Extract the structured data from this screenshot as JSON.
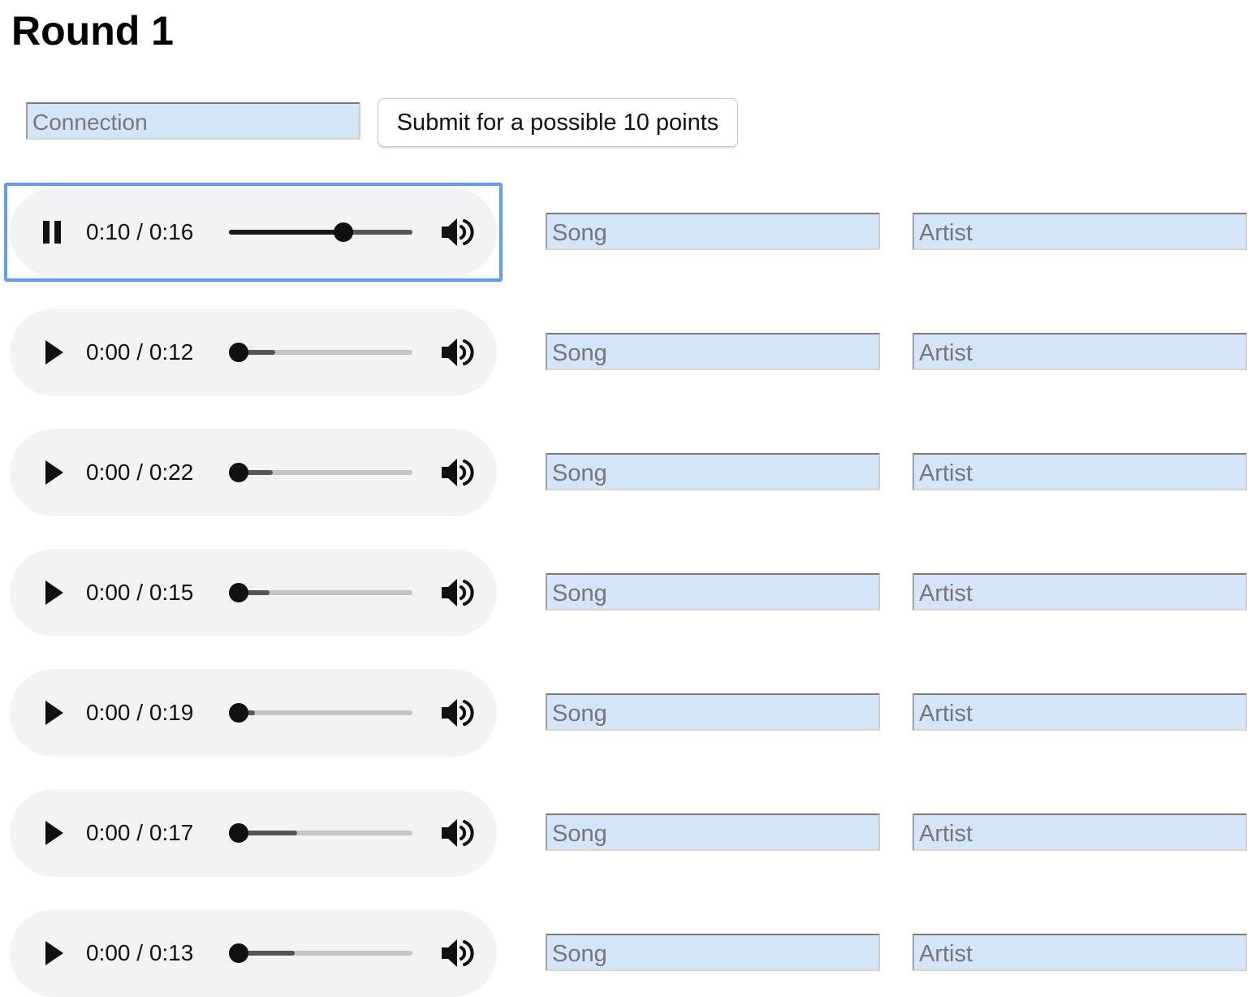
{
  "page": {
    "title": "Round 1"
  },
  "connection": {
    "placeholder": "Connection",
    "submit_label": "Submit for a possible 10 points"
  },
  "colors": {
    "input_background": "#d3e5f6",
    "player_background": "#f1f3f4",
    "focus_ring": "#5d9cf7"
  },
  "rows": [
    {
      "state": "playing",
      "time": "0:10 / 0:16",
      "progress": 0.625,
      "buffered": 1.0,
      "song_placeholder": "Song",
      "artist_placeholder": "Artist",
      "focused": true
    },
    {
      "state": "paused",
      "time": "0:00 / 0:12",
      "progress": 0.0,
      "buffered": 0.25,
      "song_placeholder": "Song",
      "artist_placeholder": "Artist",
      "focused": false
    },
    {
      "state": "paused",
      "time": "0:00 / 0:22",
      "progress": 0.0,
      "buffered": 0.24,
      "song_placeholder": "Song",
      "artist_placeholder": "Artist",
      "focused": false
    },
    {
      "state": "paused",
      "time": "0:00 / 0:15",
      "progress": 0.0,
      "buffered": 0.22,
      "song_placeholder": "Song",
      "artist_placeholder": "Artist",
      "focused": false
    },
    {
      "state": "paused",
      "time": "0:00 / 0:19",
      "progress": 0.0,
      "buffered": 0.14,
      "song_placeholder": "Song",
      "artist_placeholder": "Artist",
      "focused": false
    },
    {
      "state": "paused",
      "time": "0:00 / 0:17",
      "progress": 0.0,
      "buffered": 0.37,
      "song_placeholder": "Song",
      "artist_placeholder": "Artist",
      "focused": false
    },
    {
      "state": "paused",
      "time": "0:00 / 0:13",
      "progress": 0.0,
      "buffered": 0.36,
      "song_placeholder": "Song",
      "artist_placeholder": "Artist",
      "focused": false
    }
  ],
  "icons": {
    "play": "play-icon",
    "pause": "pause-icon",
    "volume": "volume-icon"
  }
}
